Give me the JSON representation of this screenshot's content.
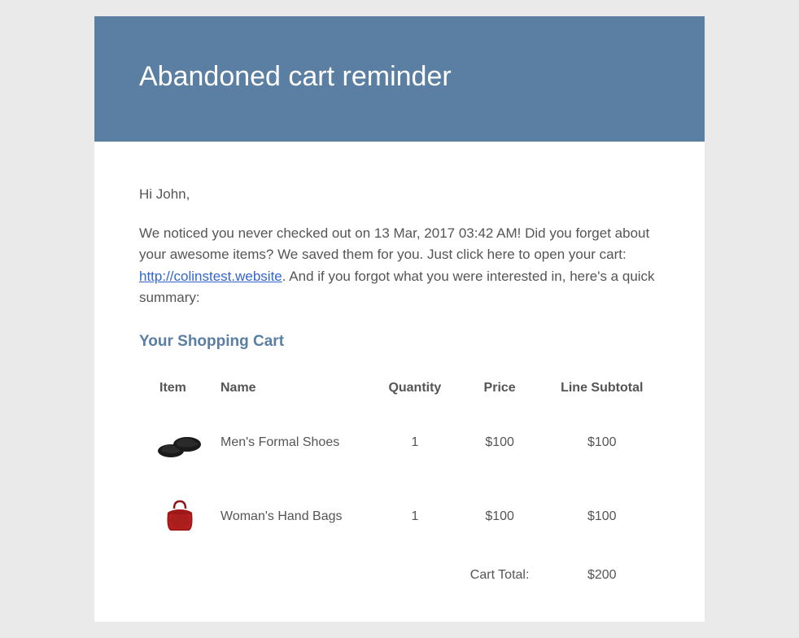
{
  "header": {
    "title": "Abandoned cart reminder"
  },
  "content": {
    "greeting": "Hi John,",
    "message_part1": "We noticed you never checked out on 13 Mar, 2017 03:42 AM! Did you forget about your awesome items? We saved them for you. Just click here to open your cart: ",
    "link_text": "http://colinstest.website",
    "message_part2": ". And if you forgot what you were interested in, here's a quick summary:",
    "section_title": "Your Shopping Cart"
  },
  "table": {
    "headers": {
      "item": "Item",
      "name": "Name",
      "quantity": "Quantity",
      "price": "Price",
      "subtotal": "Line Subtotal"
    },
    "rows": [
      {
        "name": "Men's Formal Shoes",
        "quantity": "1",
        "price": "$100",
        "subtotal": "$100"
      },
      {
        "name": "Woman's Hand Bags",
        "quantity": "1",
        "price": "$100",
        "subtotal": "$100"
      }
    ],
    "total_label": "Cart Total:",
    "total_value": "$200"
  }
}
